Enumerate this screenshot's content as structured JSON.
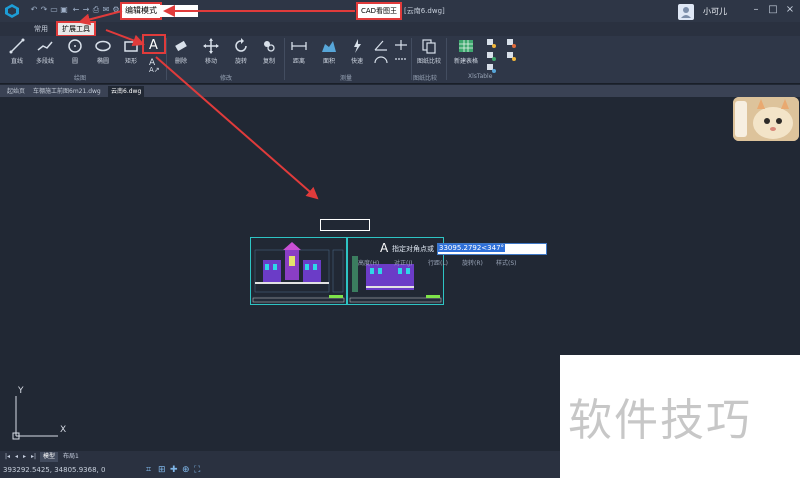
{
  "titlebar": {
    "mode_label": "编辑模式",
    "app_title": "CAD看图王",
    "doc_title": "[云南6.dwg]",
    "user_name": "小可儿",
    "minimize": "–",
    "restore": "□",
    "close": "×"
  },
  "ribbon_tabs": [
    {
      "label": "常用"
    },
    {
      "label": "扩展工具"
    }
  ],
  "ribbon": {
    "tools": [
      {
        "label": "直线",
        "icon": "line-icon"
      },
      {
        "label": "多段线",
        "icon": "polyline-icon"
      },
      {
        "label": "圆",
        "icon": "circle-icon"
      },
      {
        "label": "椭圆",
        "icon": "ellipse-icon"
      },
      {
        "label": "矩形",
        "icon": "rect-icon"
      },
      {
        "label": "A",
        "icon": "text-icon"
      },
      {
        "label": "删除",
        "icon": "eraser-icon"
      },
      {
        "label": "移动",
        "icon": "move-icon"
      },
      {
        "label": "旋转",
        "icon": "rotate-icon"
      },
      {
        "label": "复制",
        "icon": "copy-icon"
      },
      {
        "label": "距离",
        "icon": "distance-icon"
      },
      {
        "label": "面积",
        "icon": "area-icon"
      },
      {
        "label": "快速",
        "icon": "quick-measure-icon"
      },
      {
        "label": "图纸比较",
        "icon": "compare-icon"
      },
      {
        "label": "新建表格",
        "icon": "table-icon"
      }
    ],
    "groups": [
      {
        "label": "绘图"
      },
      {
        "label": "修改"
      },
      {
        "label": "测量"
      },
      {
        "label": "图纸比较"
      },
      {
        "label": "XlsTable"
      }
    ]
  },
  "doc_tabs": [
    {
      "label": "起始页"
    },
    {
      "label": "车棚施工前图6m21.dwg"
    },
    {
      "label": "云南6.dwg"
    }
  ],
  "canvas": {
    "prompt": "指定对角点或",
    "input_value": "33095.2792<347°",
    "options": [
      "高度(H)",
      "对正(J)",
      "行距(L)",
      "旋转(R)",
      "样式(S)"
    ],
    "axis_y": "Y",
    "axis_x": "X"
  },
  "layout_tabs": [
    {
      "label": "模型"
    },
    {
      "label": "布局1"
    }
  ],
  "status": {
    "coords": "393292.5425, 34805.9368, 0"
  },
  "watermark": {
    "text": "软件技巧"
  },
  "colors": {
    "annotation_red": "#e03b3b",
    "canvas_bg": "#212834",
    "accent_cyan": "#2ec4c4"
  }
}
